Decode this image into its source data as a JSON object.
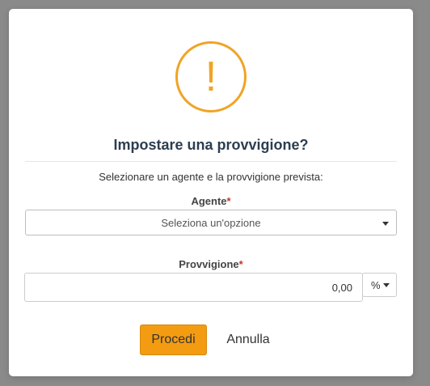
{
  "dialog": {
    "icon": "exclamation-icon",
    "title": "Impostare una provvigione?",
    "subtitle": "Selezionare un agente e la provvigione prevista:",
    "agent": {
      "label": "Agente",
      "required_mark": "*",
      "placeholder": "Seleziona un'opzione"
    },
    "commission": {
      "label": "Provvigione",
      "required_mark": "*",
      "value": "0,00",
      "unit": "%"
    },
    "confirm_label": "Procedi",
    "cancel_label": "Annulla",
    "exclamation": "!"
  },
  "colors": {
    "accent": "#f39c12",
    "warning_icon": "#f0a425",
    "title_text": "#2c3e50",
    "required": "#c0392b"
  }
}
